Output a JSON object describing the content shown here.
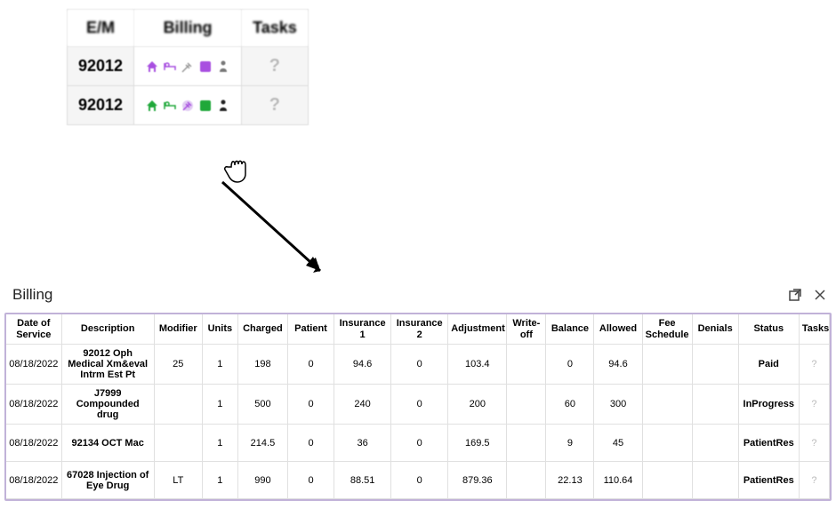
{
  "top_table": {
    "headers": {
      "em": "E/M",
      "billing": "Billing",
      "tasks": "Tasks"
    },
    "rows": [
      {
        "em": "92012",
        "icons_theme": "purple",
        "tasks_marker": "?"
      },
      {
        "em": "92012",
        "icons_theme": "green",
        "tasks_marker": "?"
      }
    ]
  },
  "icon_names": {
    "home": "home-icon",
    "bed": "bed-icon",
    "syringe": "syringe-icon",
    "square": "square-icon",
    "person": "person-icon"
  },
  "colors": {
    "purple": "#a84fe0",
    "green": "#1fa83a",
    "gray": "#777"
  },
  "billing_panel": {
    "title": "Billing",
    "headers": [
      "Date of Service",
      "Description",
      "Modifier",
      "Units",
      "Charged",
      "Patient",
      "Insurance 1",
      "Insurance 2",
      "Adjustment",
      "Write-off",
      "Balance",
      "Allowed",
      "Fee Schedule",
      "Denials",
      "Status",
      "Tasks"
    ],
    "rows": [
      {
        "date": "08/18/2022",
        "description": "92012 Oph Medical Xm&eval Intrm Est Pt",
        "modifier": "25",
        "units": "1",
        "charged": "198",
        "patient": "0",
        "ins1": "94.6",
        "ins2": "0",
        "adjustment": "103.4",
        "writeoff": "",
        "balance": "0",
        "allowed": "94.6",
        "fee": "",
        "denials": "",
        "status": "Paid",
        "tasks": "?"
      },
      {
        "date": "08/18/2022",
        "description": "J7999 Compounded drug",
        "modifier": "",
        "units": "1",
        "charged": "500",
        "patient": "0",
        "ins1": "240",
        "ins2": "0",
        "adjustment": "200",
        "writeoff": "",
        "balance": "60",
        "allowed": "300",
        "fee": "",
        "denials": "",
        "status": "InProgress",
        "tasks": "?"
      },
      {
        "date": "08/18/2022",
        "description": "92134 OCT Mac",
        "modifier": "",
        "units": "1",
        "charged": "214.5",
        "patient": "0",
        "ins1": "36",
        "ins2": "0",
        "adjustment": "169.5",
        "writeoff": "",
        "balance": "9",
        "allowed": "45",
        "fee": "",
        "denials": "",
        "status": "PatientRes",
        "tasks": "?"
      },
      {
        "date": "08/18/2022",
        "description": "67028 Injection of Eye Drug",
        "modifier": "LT",
        "units": "1",
        "charged": "990",
        "patient": "0",
        "ins1": "88.51",
        "ins2": "0",
        "adjustment": "879.36",
        "writeoff": "",
        "balance": "22.13",
        "allowed": "110.64",
        "fee": "",
        "denials": "",
        "status": "PatientRes",
        "tasks": "?"
      }
    ]
  }
}
